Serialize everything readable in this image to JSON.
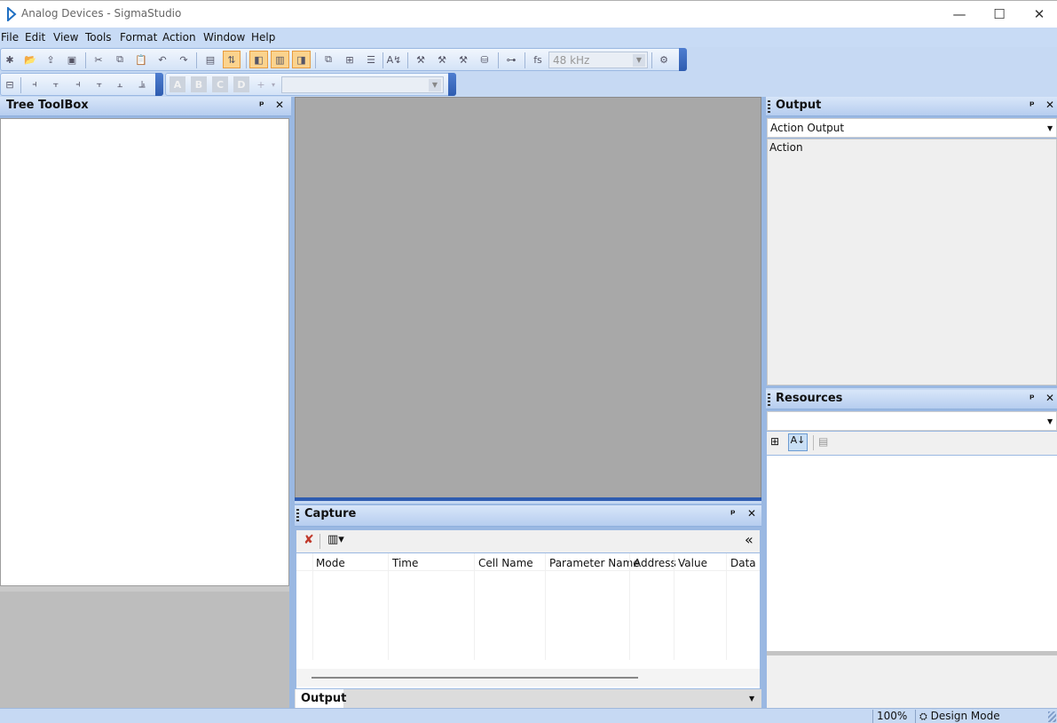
{
  "window": {
    "title": "Analog Devices - SigmaStudio",
    "controls": {
      "minimize": "—",
      "maximize": "☐",
      "close": "✕"
    }
  },
  "menu": [
    "File",
    "Edit",
    "View",
    "Tools",
    "Format",
    "Action",
    "Window",
    "Help"
  ],
  "toolbar": {
    "sample_rate": "48 kHz"
  },
  "tree_toolbox": {
    "title": "Tree ToolBox",
    "pin": "ᵖ",
    "close": "✕"
  },
  "output_panel": {
    "title": "Output",
    "dropdown_value": "Action Output",
    "content_text": "Action",
    "pin": "ᵖ",
    "close": "✕"
  },
  "resources_panel": {
    "title": "Resources",
    "pin": "ᵖ",
    "close": "✕"
  },
  "capture_panel": {
    "title": "Capture",
    "collapse": "«",
    "pin": "ᵖ",
    "close": "✕",
    "columns": [
      "Mode",
      "Time",
      "Cell Name",
      "Parameter Name",
      "Address",
      "Value",
      "Data"
    ]
  },
  "bottom_tabs": {
    "output_tab": "Output"
  },
  "status": {
    "zoom": "100%",
    "mode": "Design Mode"
  },
  "colors": {
    "workspace": "#a8a8a8",
    "chrome": "#c6d9f3",
    "accent": "#2e5cb0",
    "active_button": "#fbd38d"
  }
}
